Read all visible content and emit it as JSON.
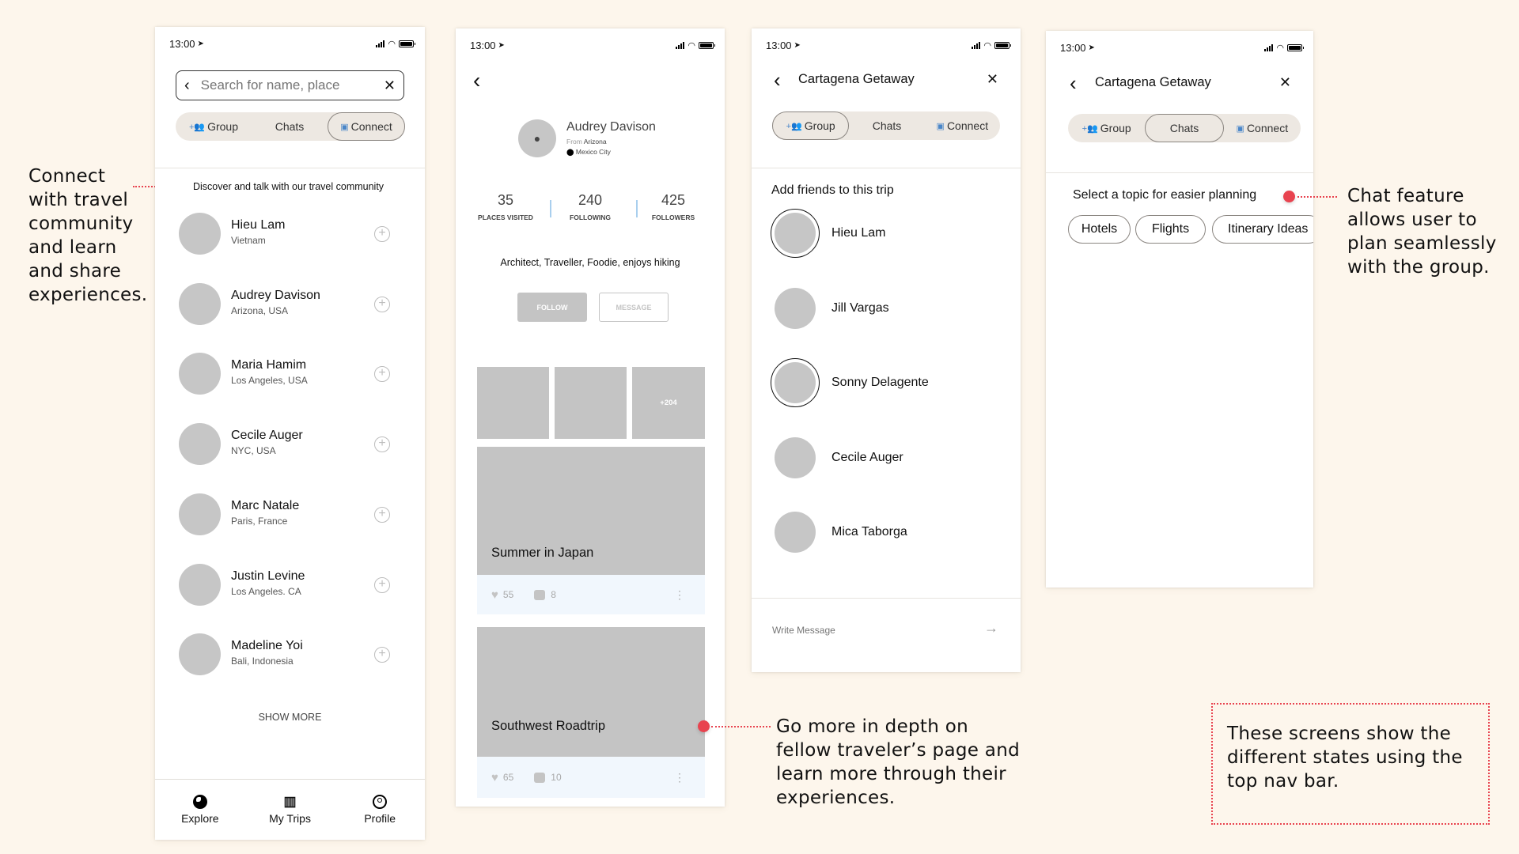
{
  "status_bar": {
    "time": "13:00"
  },
  "annotations": {
    "left": "Connect with travel community and learn and share experiences.",
    "middle": "Go more in depth on fellow traveler’s page and learn more through their experiences.",
    "right": "Chat feature allows user to plan seamlessly with the group.",
    "box": "These screens show the different states using the top nav bar."
  },
  "colors": {
    "accent": "#e8434f",
    "background": "#fdf6ec",
    "placeholder": "#c4c4c4",
    "icon_blue": "#4a86c8"
  },
  "segments": {
    "group": "Group",
    "chats": "Chats",
    "connect": "Connect"
  },
  "screen_connect": {
    "search_placeholder": "Search for name, place",
    "active_segment": "Connect",
    "intro": "Discover and talk with our travel community",
    "people": [
      {
        "name": "Hieu Lam",
        "location": "Vietnam"
      },
      {
        "name": "Audrey Davison",
        "location": "Arizona, USA"
      },
      {
        "name": "Maria Hamim",
        "location": "Los Angeles, USA"
      },
      {
        "name": "Cecile Auger",
        "location": "NYC, USA"
      },
      {
        "name": "Marc Natale",
        "location": "Paris, France"
      },
      {
        "name": "Justin Levine",
        "location": "Los Angeles. CA"
      },
      {
        "name": "Madeline Yoi",
        "location": "Bali, Indonesia"
      }
    ],
    "show_more": "SHOW MORE",
    "tabbar": [
      {
        "label": "Explore",
        "icon": "globe-icon"
      },
      {
        "label": "My Trips",
        "icon": "map-icon"
      },
      {
        "label": "Profile",
        "icon": "profile-icon"
      }
    ]
  },
  "screen_profile": {
    "name": "Audrey Davison",
    "from_label": "From",
    "from_value": "Arizona",
    "location": "Mexico City",
    "stats": [
      {
        "value": "35",
        "label": "PLACES VISITED"
      },
      {
        "value": "240",
        "label": "FOLLOWING"
      },
      {
        "value": "425",
        "label": "FOLLOWERS"
      }
    ],
    "bio": "Architect, Traveller, Foodie, enjoys hiking",
    "follow": "FOLLOW",
    "message": "MESSAGE",
    "more_photos": "+204",
    "cards": [
      {
        "title": "Summer in Japan",
        "likes": "55",
        "comments": "8"
      },
      {
        "title": "Southwest Roadtrip",
        "likes": "65",
        "comments": "10"
      }
    ]
  },
  "screen_group": {
    "title": "Cartagena Getaway",
    "active_segment": "Group",
    "heading": "Add friends to this trip",
    "friends": [
      {
        "name": "Hieu Lam",
        "selected": true
      },
      {
        "name": "Jill Vargas",
        "selected": false
      },
      {
        "name": "Sonny Delagente",
        "selected": true
      },
      {
        "name": "Cecile Auger",
        "selected": false
      },
      {
        "name": "Mica Taborga",
        "selected": false
      }
    ],
    "message_placeholder": "Write Message"
  },
  "screen_chats": {
    "title": "Cartagena Getaway",
    "active_segment": "Chats",
    "heading": "Select a topic for easier planning",
    "topics": [
      "Hotels",
      "Flights",
      "Itinerary Ideas"
    ]
  }
}
